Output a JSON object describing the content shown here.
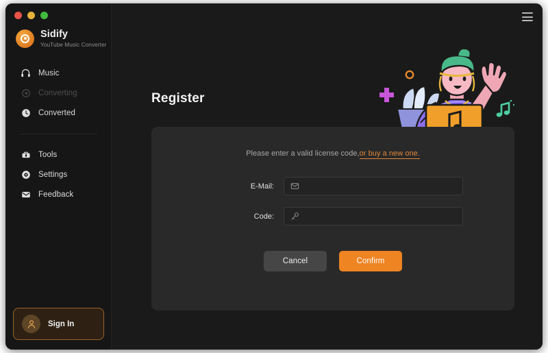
{
  "window": {
    "traffic_lights": [
      {
        "name": "close",
        "color": "#e9544a"
      },
      {
        "name": "minimize",
        "color": "#e7b13a"
      },
      {
        "name": "maximize",
        "color": "#42b93f"
      }
    ],
    "menu_icon": "hamburger-menu-icon"
  },
  "brand": {
    "name": "Sidify",
    "subtitle": "YouTube Music Converter",
    "logo_icon": "sidify-disc-logo",
    "logo_color": "#e07c22"
  },
  "sidebar": {
    "items": [
      {
        "label": "Music",
        "icon": "headphones-icon",
        "disabled": false
      },
      {
        "label": "Converting",
        "icon": "converting-icon",
        "disabled": true
      },
      {
        "label": "Converted",
        "icon": "clock-icon",
        "disabled": false
      }
    ],
    "items_secondary": [
      {
        "label": "Tools",
        "icon": "toolbox-icon",
        "disabled": false
      },
      {
        "label": "Settings",
        "icon": "gear-icon",
        "disabled": false
      },
      {
        "label": "Feedback",
        "icon": "envelope-icon",
        "disabled": false
      }
    ],
    "sign_in": {
      "label": "Sign In",
      "icon": "user-avatar-icon",
      "accent_color": "#9a6227"
    }
  },
  "main": {
    "page_title": "Register",
    "card": {
      "hint_text": "Please enter a valid license code,",
      "hint_link": "or buy a new one.",
      "hint_link_color": "#e2873a",
      "fields": [
        {
          "label": "E-Mail:",
          "icon": "envelope-icon",
          "value": "",
          "placeholder": ""
        },
        {
          "label": "Code:",
          "icon": "key-icon",
          "value": "",
          "placeholder": ""
        }
      ],
      "buttons": [
        {
          "label": "Cancel",
          "style": "secondary",
          "color": "#464646"
        },
        {
          "label": "Confirm",
          "style": "primary",
          "color": "#ef8422"
        }
      ]
    },
    "illustration": {
      "name": "person-with-laptop-illustration",
      "elements": [
        "green-hair-person",
        "purple-shirt",
        "orange-laptop",
        "music-note-on-laptop",
        "waving-hand",
        "potted-plant",
        "magenta-plus",
        "orange-ring",
        "green-music-note"
      ]
    }
  },
  "colors": {
    "window_bg": "#141414",
    "sidebar_bg": "#161616",
    "main_bg": "#1a1a1a",
    "card_bg": "#292929",
    "accent": "#ef8422"
  }
}
